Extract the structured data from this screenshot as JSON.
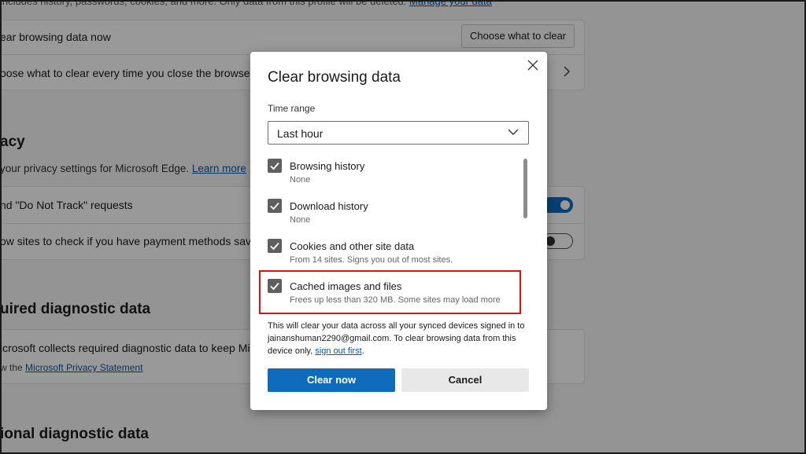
{
  "background": {
    "top_text": "includes history, passwords, cookies, and more. Only data from this profile will be deleted.",
    "top_link": "Manage your data",
    "clear_now_label": "ear browsing data now",
    "choose_button": "Choose what to clear",
    "choose_every_time": "oose what to clear every time you close the browser",
    "privacy_title": "acy",
    "privacy_desc": " your privacy settings for Microsoft Edge.",
    "privacy_link": "Learn more",
    "dnt_label": "nd \"Do Not Track\" requests",
    "payment_label": "ow sites to check if you have payment methods saved",
    "required_title": "uired diagnostic data",
    "required_desc": "icrosoft collects required diagnostic data to keep Micr",
    "required_sub_prefix": "w the",
    "privacy_statement_link": "Microsoft Privacy Statement",
    "optional_title": "ional diagnostic data"
  },
  "dialog": {
    "title": "Clear browsing data",
    "time_range_label": "Time range",
    "time_range_value": "Last hour",
    "items": [
      {
        "title": "Browsing history",
        "sub": "None",
        "checked": true
      },
      {
        "title": "Download history",
        "sub": "None",
        "checked": true
      },
      {
        "title": "Cookies and other site data",
        "sub": "From 14 sites. Signs you out of most sites.",
        "checked": true
      },
      {
        "title": "Cached images and files",
        "sub": "Frees up less than 320 MB. Some sites may load more",
        "checked": true
      }
    ],
    "info_prefix": "This will clear your data across all your synced devices signed in to jainanshuman2290@gmail.com. To clear browsing data from this device only, ",
    "info_link": "sign out first",
    "info_suffix": ".",
    "clear_button": "Clear now",
    "cancel_button": "Cancel"
  },
  "colors": {
    "accent": "#0f6cbd",
    "highlight": "#e01010",
    "checkbox": "#5f5f5f"
  }
}
